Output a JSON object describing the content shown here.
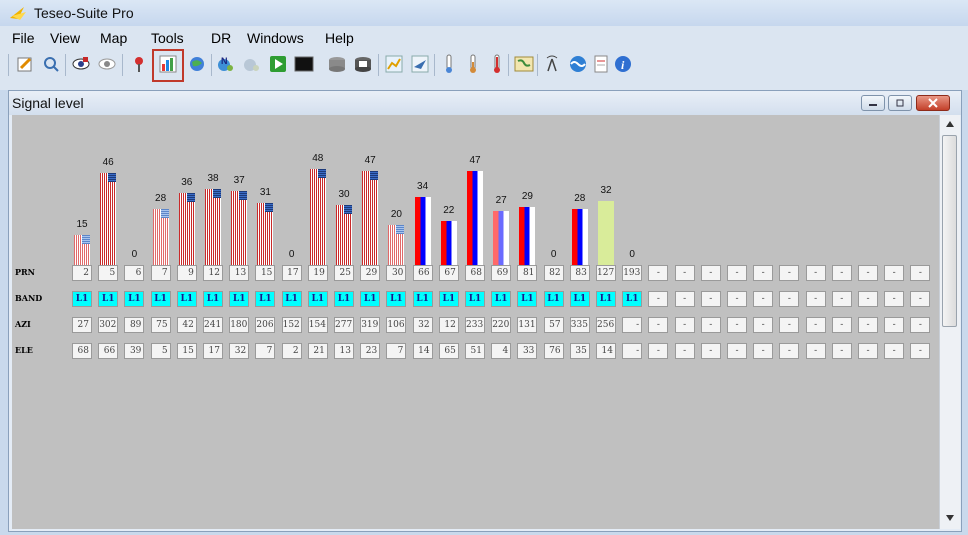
{
  "app": {
    "title": "Teseo-Suite Pro"
  },
  "menu": [
    "File",
    "View",
    "Map",
    "Tools",
    "DR",
    "Windows",
    "Help"
  ],
  "toolbar_icons": [
    "edit-icon",
    "search-icon",
    "antenna-eye-icon",
    "eye-icon",
    "pin-icon",
    "bar-chart-icon",
    "globe-icon",
    "navigation-icon",
    "navigation-disabled-icon",
    "play-icon",
    "terminal-icon",
    "database-icon",
    "database-save-icon",
    "map-icon",
    "plane-icon",
    "thermometer-low-icon",
    "thermometer-mid-icon",
    "thermometer-high-icon",
    "world-map-icon",
    "signal-tower-icon",
    "wave-icon",
    "document-icon",
    "info-icon"
  ],
  "window": {
    "title": "Signal level"
  },
  "labels": {
    "prn": "PRN",
    "band": "BAND",
    "azi": "AZI",
    "ele": "ELE"
  },
  "chart_data": {
    "type": "bar",
    "title": "Signal level",
    "categories": [
      "2",
      "5",
      "6",
      "7",
      "9",
      "12",
      "13",
      "15",
      "17",
      "19",
      "25",
      "29",
      "30",
      "66",
      "67",
      "68",
      "69",
      "81",
      "82",
      "83",
      "127",
      "193"
    ],
    "values": [
      15,
      46,
      0,
      28,
      36,
      38,
      37,
      31,
      0,
      48,
      30,
      47,
      20,
      34,
      22,
      47,
      27,
      29,
      0,
      28,
      32,
      0
    ],
    "ylim": [
      0,
      60
    ]
  },
  "satellites": [
    {
      "prn": "2",
      "band": "L1",
      "azi": "27",
      "ele": "68",
      "style": "stripe-light"
    },
    {
      "prn": "5",
      "band": "L1",
      "azi": "302",
      "ele": "66",
      "style": "stripe"
    },
    {
      "prn": "6",
      "band": "L1",
      "azi": "89",
      "ele": "39",
      "style": "none"
    },
    {
      "prn": "7",
      "band": "L1",
      "azi": "75",
      "ele": "5",
      "style": "stripe-light"
    },
    {
      "prn": "9",
      "band": "L1",
      "azi": "42",
      "ele": "15",
      "style": "stripe"
    },
    {
      "prn": "12",
      "band": "L1",
      "azi": "241",
      "ele": "17",
      "style": "stripe"
    },
    {
      "prn": "13",
      "band": "L1",
      "azi": "180",
      "ele": "32",
      "style": "stripe"
    },
    {
      "prn": "15",
      "band": "L1",
      "azi": "206",
      "ele": "7",
      "style": "stripe"
    },
    {
      "prn": "17",
      "band": "L1",
      "azi": "152",
      "ele": "2",
      "style": "none"
    },
    {
      "prn": "19",
      "band": "L1",
      "azi": "154",
      "ele": "21",
      "style": "stripe"
    },
    {
      "prn": "25",
      "band": "L1",
      "azi": "277",
      "ele": "13",
      "style": "stripe"
    },
    {
      "prn": "29",
      "band": "L1",
      "azi": "319",
      "ele": "23",
      "style": "stripe"
    },
    {
      "prn": "30",
      "band": "L1",
      "azi": "106",
      "ele": "7",
      "style": "stripe-light"
    },
    {
      "prn": "66",
      "band": "L1",
      "azi": "32",
      "ele": "14",
      "style": "gps"
    },
    {
      "prn": "67",
      "band": "L1",
      "azi": "12",
      "ele": "65",
      "style": "gps"
    },
    {
      "prn": "68",
      "band": "L1",
      "azi": "233",
      "ele": "51",
      "style": "gps"
    },
    {
      "prn": "69",
      "band": "L1",
      "azi": "220",
      "ele": "4",
      "style": "gps-faded"
    },
    {
      "prn": "81",
      "band": "L1",
      "azi": "131",
      "ele": "33",
      "style": "gps"
    },
    {
      "prn": "82",
      "band": "L1",
      "azi": "57",
      "ele": "76",
      "style": "none"
    },
    {
      "prn": "83",
      "band": "L1",
      "azi": "335",
      "ele": "35",
      "style": "gps"
    },
    {
      "prn": "127",
      "band": "L1",
      "azi": "256",
      "ele": "14",
      "style": "sbas"
    },
    {
      "prn": "193",
      "band": "L1",
      "azi": "-",
      "ele": "-",
      "style": "none"
    }
  ],
  "empty_slot_text": "-",
  "empty_slot_count": 11
}
